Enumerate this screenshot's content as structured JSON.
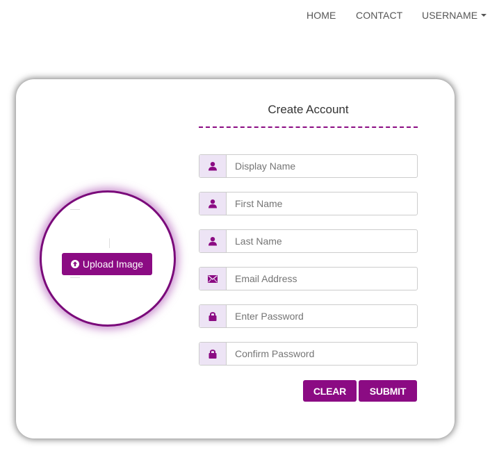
{
  "nav": {
    "home": "HOME",
    "contact": "CONTACT",
    "username": "USERNAME"
  },
  "avatar": {
    "upload_label": "Upload Image"
  },
  "form": {
    "title": "Create Account",
    "fields": [
      {
        "placeholder": "Display Name",
        "icon": "user-icon"
      },
      {
        "placeholder": "First Name",
        "icon": "user-icon"
      },
      {
        "placeholder": "Last Name",
        "icon": "user-icon"
      },
      {
        "placeholder": "Email Address",
        "icon": "envelope-icon"
      },
      {
        "placeholder": "Enter Password",
        "icon": "lock-icon"
      },
      {
        "placeholder": "Confirm Password",
        "icon": "lock-icon"
      }
    ],
    "clear_label": "CLEAR",
    "submit_label": "SUBMIT"
  },
  "colors": {
    "accent": "#8b0b83",
    "addon_bg": "#ede4f5"
  }
}
